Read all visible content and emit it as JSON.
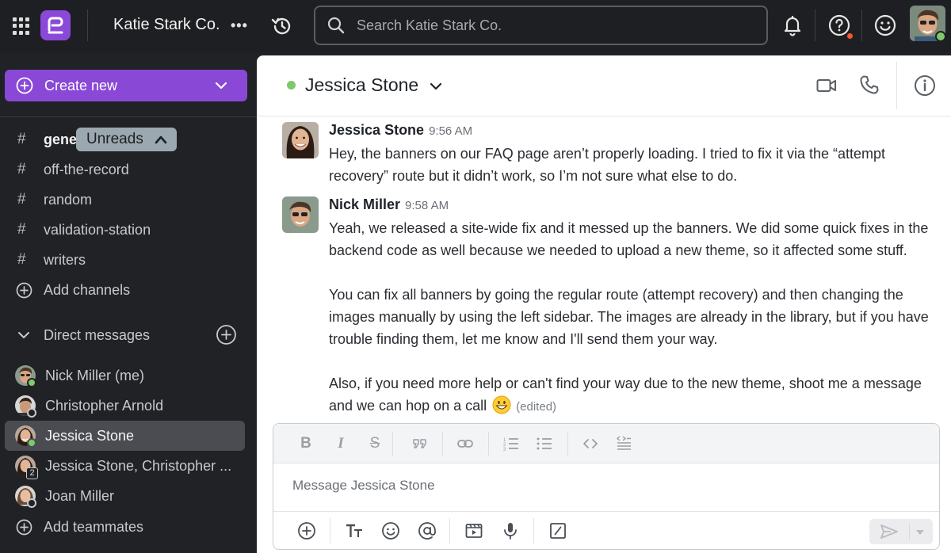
{
  "topbar": {
    "workspace_name": "Katie Stark Co.",
    "more_label": "•••",
    "search_placeholder": "Search Katie Stark Co.",
    "icons": [
      "apps-grid-icon",
      "logo",
      "history-icon",
      "search-icon",
      "bell-icon",
      "help-icon",
      "emoji-status-icon",
      "user-avatar"
    ],
    "help_alert_color": "#f15a29",
    "presence_color": "#7ec96b"
  },
  "sidebar": {
    "create_new_label": "Create new",
    "accent_color": "#8948d6",
    "partial_channel_label": "gene",
    "unreads_label": "Unreads",
    "channels": [
      {
        "label": "off-the-record"
      },
      {
        "label": "random"
      },
      {
        "label": "validation-station"
      },
      {
        "label": "writers"
      }
    ],
    "add_channels_label": "Add channels",
    "dm_header_label": "Direct messages",
    "direct_messages": [
      {
        "label": "Nick Miller (me)",
        "status": "online"
      },
      {
        "label": "Christopher Arnold",
        "status": "away"
      },
      {
        "label": "Jessica Stone",
        "status": "online",
        "active": true
      },
      {
        "label": "Jessica Stone, Christopher ...",
        "count": "2"
      },
      {
        "label": "Joan Miller",
        "status": "away"
      }
    ],
    "add_teammates_label": "Add teammates"
  },
  "conversation": {
    "title": "Jessica Stone",
    "presence": "online",
    "messages": [
      {
        "author": "Jessica Stone",
        "time": "9:56 AM",
        "paragraphs": [
          "Hey, the banners on our FAQ page aren’t properly loading. I tried to fix it via the “attempt recovery” route but it didn’t work, so I’m not sure what else to do."
        ]
      },
      {
        "author": "Nick Miller",
        "time": "9:58 AM",
        "paragraphs": [
          "Yeah, we released a site-wide fix and it messed up the banners. We did some quick fixes in the backend code as well because we needed to upload a new theme, so it affected some stuff.",
          "You can fix all banners by going the regular route (attempt recovery) and then changing the images manually by using the left sidebar. The images are already in the library, but if you have trouble finding them, let me know and I'll send them your way.",
          "Also, if you need more help or can't find your way due to the new theme, shoot me a message and we can hop on a call"
        ],
        "edited_label": "(edited)"
      }
    ]
  },
  "composer": {
    "placeholder": "Message Jessica Stone",
    "format_buttons": [
      "B",
      "I",
      "S",
      "quote",
      "link",
      "numbered-list",
      "bulleted-list",
      "code",
      "code-block"
    ],
    "action_buttons": [
      "add",
      "text-format",
      "emoji",
      "mention",
      "video-clip",
      "microphone",
      "slash-command",
      "send"
    ]
  }
}
